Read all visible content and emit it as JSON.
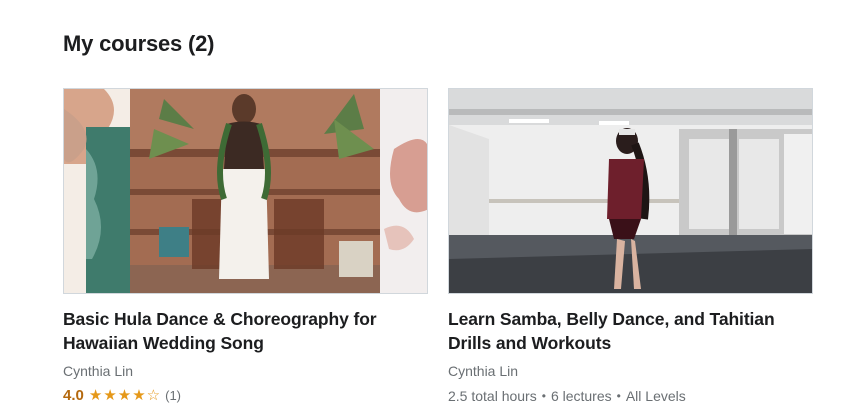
{
  "page": {
    "title": "My courses (2)"
  },
  "courses": [
    {
      "title": "Basic Hula Dance & Choreography for Hawaiian Wedding Song",
      "instructor": "Cynthia Lin",
      "rating": "4.0",
      "rating_value": 4.0,
      "stars_max": 5,
      "review_count": "(1)"
    },
    {
      "title": "Learn Samba, Belly Dance, and Tahitian Drills and Workouts",
      "instructor": "Cynthia Lin",
      "details": {
        "hours": "2.5 total hours",
        "lectures": "6 lectures",
        "level": "All Levels"
      }
    }
  ],
  "icons": {
    "star_filled": "star-icon",
    "star_empty": "star-outline-icon",
    "separator": "dot-separator"
  },
  "colors": {
    "rating": "#b4690e",
    "star": "#e59819",
    "muted_text": "#6a6f73",
    "title_text": "#1c1d1f"
  }
}
